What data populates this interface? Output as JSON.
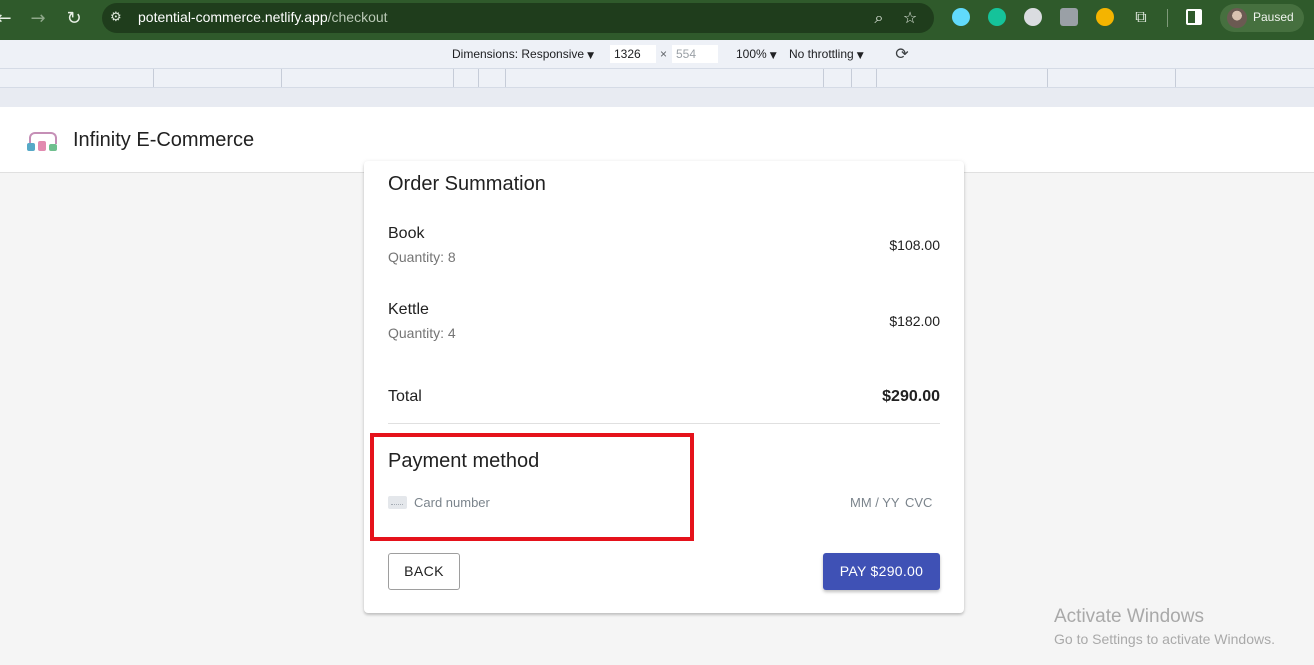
{
  "browser": {
    "url_host": "potential-commerce.netlify.app",
    "url_path": "/checkout",
    "profile_status": "Paused",
    "icons": {
      "back": "arrow-left-icon",
      "forward": "arrow-right-icon",
      "reload": "reload-icon",
      "site_info": "tune-icon",
      "zoom": "zoom-icon",
      "bookmark": "star-icon",
      "extensions": "puzzle-icon",
      "side_panel": "side-panel-icon"
    },
    "extension_colors": [
      "#61dafb",
      "#15c39a",
      "#dadce0",
      "#9aa0a6",
      "#f4b400"
    ]
  },
  "devtools": {
    "dimensions_label": "Dimensions: Responsive",
    "width": "1326",
    "height": "554",
    "times": "×",
    "zoom": "100%",
    "throttling": "No throttling",
    "rotate_icon": "rotate-icon"
  },
  "header": {
    "brand": "Infinity E-Commerce",
    "logo_icon": "store-logo-icon"
  },
  "order": {
    "title": "Order Summation",
    "items": [
      {
        "name": "Book",
        "quantity": "Quantity: 8",
        "price": "$108.00"
      },
      {
        "name": "Kettle",
        "quantity": "Quantity: 4",
        "price": "$182.00"
      }
    ],
    "total_label": "Total",
    "total_value": "$290.00"
  },
  "payment": {
    "title": "Payment method",
    "card_placeholder": "Card number",
    "expiry_placeholder": "MM / YY",
    "cvc_placeholder": "CVC",
    "card_icon": "credit-card-icon"
  },
  "actions": {
    "back": "BACK",
    "pay": "PAY $290.00"
  },
  "watermark": {
    "title": "Activate Windows",
    "subtitle": "Go to Settings to activate Windows."
  },
  "colors": {
    "chrome_bg": "#2f5a2b",
    "primary": "#3f51b5",
    "highlight": "#e5121b"
  }
}
